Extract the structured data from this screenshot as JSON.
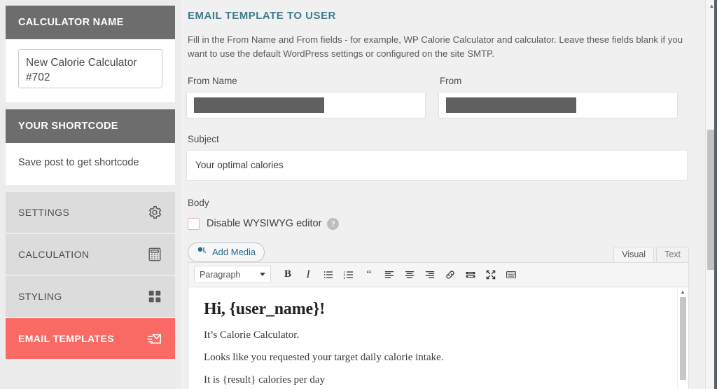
{
  "sidebar": {
    "calculator_name_panel": {
      "title": "CALCULATOR NAME",
      "input_value": "New Calorie Calculator #702"
    },
    "shortcode_panel": {
      "title": "YOUR SHORTCODE",
      "text": "Save post to get shortcode"
    },
    "nav_items": [
      {
        "label": "SETTINGS",
        "icon": "gear-icon",
        "active": false
      },
      {
        "label": "CALCULATION",
        "icon": "calculator-icon",
        "active": false
      },
      {
        "label": "STYLING",
        "icon": "grid-icon",
        "active": false
      },
      {
        "label": "EMAIL TEMPLATES",
        "icon": "envelope-icon",
        "active": true
      }
    ],
    "active_color": "#fa6a65",
    "header_color": "#6d6d6d"
  },
  "main": {
    "page_title": "EMAIL TEMPLATE TO USER",
    "title_color": "#3d7d8c",
    "description": "Fill in the From Name and From fields - for example, WP Calorie Calculator and calculator. Leave these fields blank if you want to use the default WordPress settings or configured on the site SMTP.",
    "from_name": {
      "label": "From Name",
      "value": "",
      "redacted": true
    },
    "from": {
      "label": "From",
      "value": "",
      "redacted": true
    },
    "subject": {
      "label": "Subject",
      "value": "Your optimal calories"
    },
    "body": {
      "label": "Body",
      "disable_wysiwyg": {
        "label": "Disable WYSIWYG editor",
        "checked": false
      },
      "help_icon_glyph": "?"
    },
    "editor": {
      "add_media_label": "Add Media",
      "add_media_icon": "media-icon",
      "tabs": [
        {
          "label": "Visual",
          "active": true
        },
        {
          "label": "Text",
          "active": false
        }
      ],
      "format_select": {
        "value": "Paragraph"
      },
      "toolbar_buttons": [
        {
          "name": "bold-icon",
          "glyph": "B"
        },
        {
          "name": "italic-icon",
          "glyph": "I"
        },
        {
          "name": "bulleted-list-icon",
          "glyph": ""
        },
        {
          "name": "numbered-list-icon",
          "glyph": ""
        },
        {
          "name": "blockquote-icon",
          "glyph": "“"
        },
        {
          "name": "align-left-icon",
          "glyph": ""
        },
        {
          "name": "align-center-icon",
          "glyph": ""
        },
        {
          "name": "align-right-icon",
          "glyph": ""
        },
        {
          "name": "link-icon",
          "glyph": ""
        },
        {
          "name": "read-more-icon",
          "glyph": ""
        },
        {
          "name": "fullscreen-icon",
          "glyph": ""
        },
        {
          "name": "toolbar-toggle-icon",
          "glyph": ""
        }
      ],
      "content": {
        "heading": "Hi, {user_name}!",
        "paragraphs": [
          "It’s Calorie Calculator.",
          "Looks like you requested your target daily calorie intake.",
          "It is {result} calories per day"
        ]
      }
    }
  }
}
